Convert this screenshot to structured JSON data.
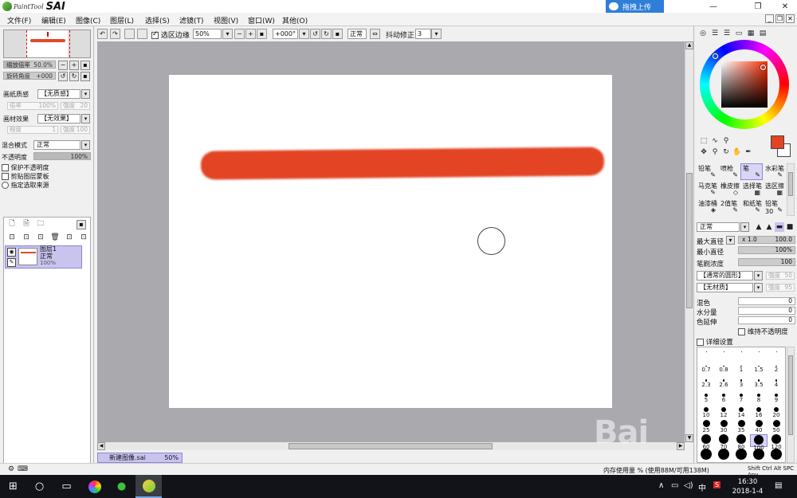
{
  "app": {
    "logo_prefix": "PaintTool",
    "logo_name": "SAI"
  },
  "title_bar": {
    "upload_label": "拖拽上传",
    "min": "—",
    "max": "❐",
    "close": "✕"
  },
  "menu": [
    "文件(F)",
    "编辑(E)",
    "图像(C)",
    "图层(L)",
    "选择(S)",
    "滤镜(T)",
    "视图(V)",
    "窗口(W)",
    "其他(O)"
  ],
  "toolbar": {
    "selection_edge_label": "选区边缘",
    "zoom_value": "50%",
    "rotation_value": "+000°",
    "mode_value": "正常",
    "stabilizer_label": "抖动修正",
    "stabilizer_value": "3"
  },
  "navigator": {
    "zoom_label": "缩放倍率",
    "zoom_value": "50.0%",
    "rotate_label": "旋转角度",
    "rotate_value": "+000"
  },
  "paper": {
    "texture_label": "画纸质感",
    "texture_value": "【无质感】",
    "scale_label": "倍率",
    "scale_value": "100%",
    "strength_label": "强度",
    "strength_value": "20",
    "effect_label": "画材效果",
    "effect_value": "【无效果】",
    "degree_label": "程度",
    "degree_value": "1",
    "strength2_label": "强度",
    "strength2_value": "100"
  },
  "layer_settings": {
    "blend_label": "混合模式",
    "blend_value": "正常",
    "opacity_label": "不透明度",
    "opacity_value": "100%",
    "protect_opacity": "保护不透明度",
    "clipping": "剪贴图层蒙板",
    "select_source": "指定选取来源"
  },
  "layers": [
    {
      "name": "图层1",
      "mode": "正常",
      "opacity": "100%"
    }
  ],
  "document_tab": {
    "name": "新建图像.sai",
    "zoom": "50%"
  },
  "brush_tools": [
    [
      "铅笔",
      "喷枪",
      "笔",
      "水彩笔"
    ],
    [
      "马克笔",
      "橡皮擦",
      "选择笔",
      "选区擦"
    ],
    [
      "油漆桶",
      "2值笔",
      "和纸笔",
      "铅笔30"
    ]
  ],
  "brush_selected": "笔",
  "brush_settings": {
    "mode_value": "正常",
    "max_size_label": "最大直径",
    "max_size_multiplier": "x 1.0",
    "max_size_value": "100.0",
    "min_size_label": "最小直径",
    "min_size_value": "100%",
    "density_label": "笔刷浓度",
    "density_value": "100",
    "shape_value": "【通常的圆形】",
    "shape_strength_label": "强度",
    "shape_strength_value": "50",
    "texture_value": "【无材质】",
    "texture_strength_label": "强度",
    "texture_strength_value": "95",
    "blend_label": "混色",
    "blend_value": "0",
    "water_label": "水分量",
    "water_value": "0",
    "persistence_label": "色延伸",
    "persistence_value": "0",
    "keep_opacity": "维持不透明度",
    "detail": "详细设置"
  },
  "brush_sizes": [
    [
      "",
      "",
      "",
      "",
      ""
    ],
    [
      "0.7",
      "0.8",
      "1",
      "1.5",
      "2"
    ],
    [
      "2.3",
      "2.6",
      "3",
      "3.5",
      "4"
    ],
    [
      "5",
      "6",
      "7",
      "8",
      "9"
    ],
    [
      "10",
      "12",
      "14",
      "16",
      "20"
    ],
    [
      "25",
      "30",
      "35",
      "40",
      "50"
    ],
    [
      "60",
      "70",
      "80",
      "100",
      "120"
    ],
    [
      "",
      "",
      "",
      "",
      ""
    ]
  ],
  "brush_size_selected": "100",
  "status": {
    "memory": "内存使用量 % (使用88M/可用138M)",
    "keys": "Shift Ctrl Alt SPC Any"
  },
  "taskbar": {
    "time": "16:30",
    "date": "2018-1-4",
    "ime": "中"
  },
  "colors": {
    "foreground": "#e24424",
    "background": "#ffffff",
    "accent": "#2f7ed8",
    "selection": "#c9c4ee"
  }
}
